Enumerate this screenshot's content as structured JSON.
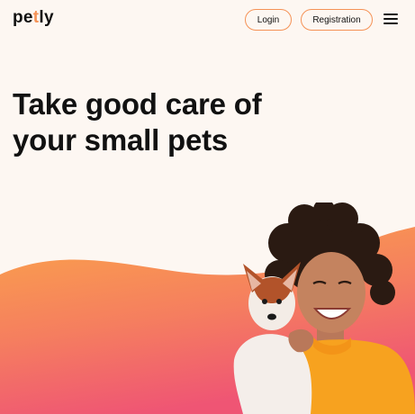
{
  "header": {
    "logo": {
      "prefix": "pe",
      "accent": "t",
      "suffix": "ly"
    },
    "login_label": "Login",
    "registration_label": "Registration",
    "menu_icon": "hamburger-menu-icon"
  },
  "hero": {
    "title_line1": "Take good care of",
    "title_line2": "your small pets",
    "illustration": "woman-holding-puppy"
  },
  "colors": {
    "background": "#FDF7F2",
    "accent": "#F59256",
    "text": "#111111",
    "wave_orange": "#F8A04A",
    "wave_pink": "#F05B7A"
  }
}
